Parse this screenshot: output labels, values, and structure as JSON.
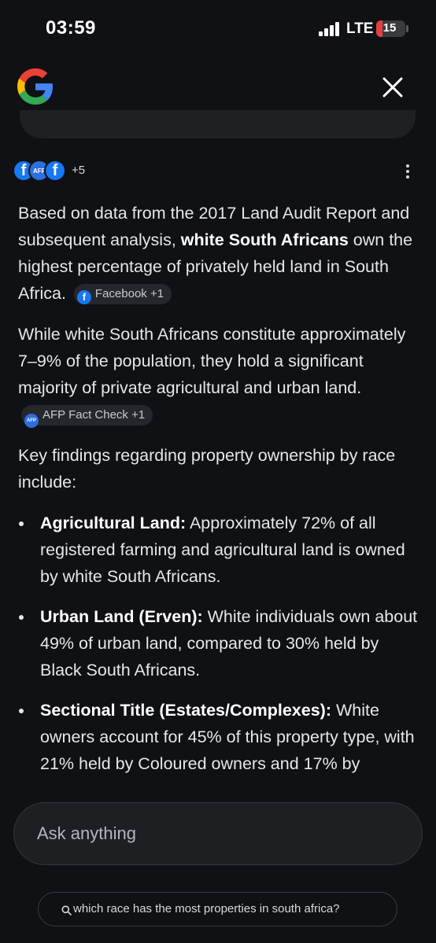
{
  "status_bar": {
    "time": "03:59",
    "network": "LTE",
    "battery_percent": 15,
    "battery_label": "15"
  },
  "sources": {
    "icons": [
      "facebook-icon",
      "afp-icon",
      "facebook-icon"
    ],
    "afp_label": "AFP",
    "extra_count": "+5"
  },
  "answer": {
    "p1_before": "Based on data from the 2017 Land Audit Report and subsequent analysis, ",
    "p1_bold": "white South Africans",
    "p1_after": " own the highest percentage of privately held land in South Africa.",
    "p1_chip": "Facebook +1",
    "p2_text": "While white South Africans constitute approximately 7–9% of the population, they hold a significant majority of private agricultural and urban land.",
    "p2_chip": "AFP Fact Check +1",
    "chip_afp_icon_label": "AFP",
    "p3_text": "Key findings regarding property ownership by race include:",
    "bullets": [
      {
        "title": "Agricultural Land:",
        "text": " Approximately 72% of all registered farming and agricultural land is owned by white South Africans."
      },
      {
        "title": "Urban Land (Erven):",
        "text": " White individuals own about 49% of urban land, compared to 30% held by Black South Africans."
      },
      {
        "title": "Sectional Title (Estates/Complexes):",
        "text": " White owners account for 45% of this property type, with 21% held by Coloured owners and 17% by"
      }
    ]
  },
  "input": {
    "placeholder": "Ask anything"
  },
  "query": {
    "text": "which race has the most properties in south africa?"
  },
  "colors": {
    "background": "#101114",
    "text": "#e6e7ea",
    "battery_red": "#e5403c",
    "facebook_blue": "#1877f2",
    "afp_blue": "#2c6fe0"
  }
}
